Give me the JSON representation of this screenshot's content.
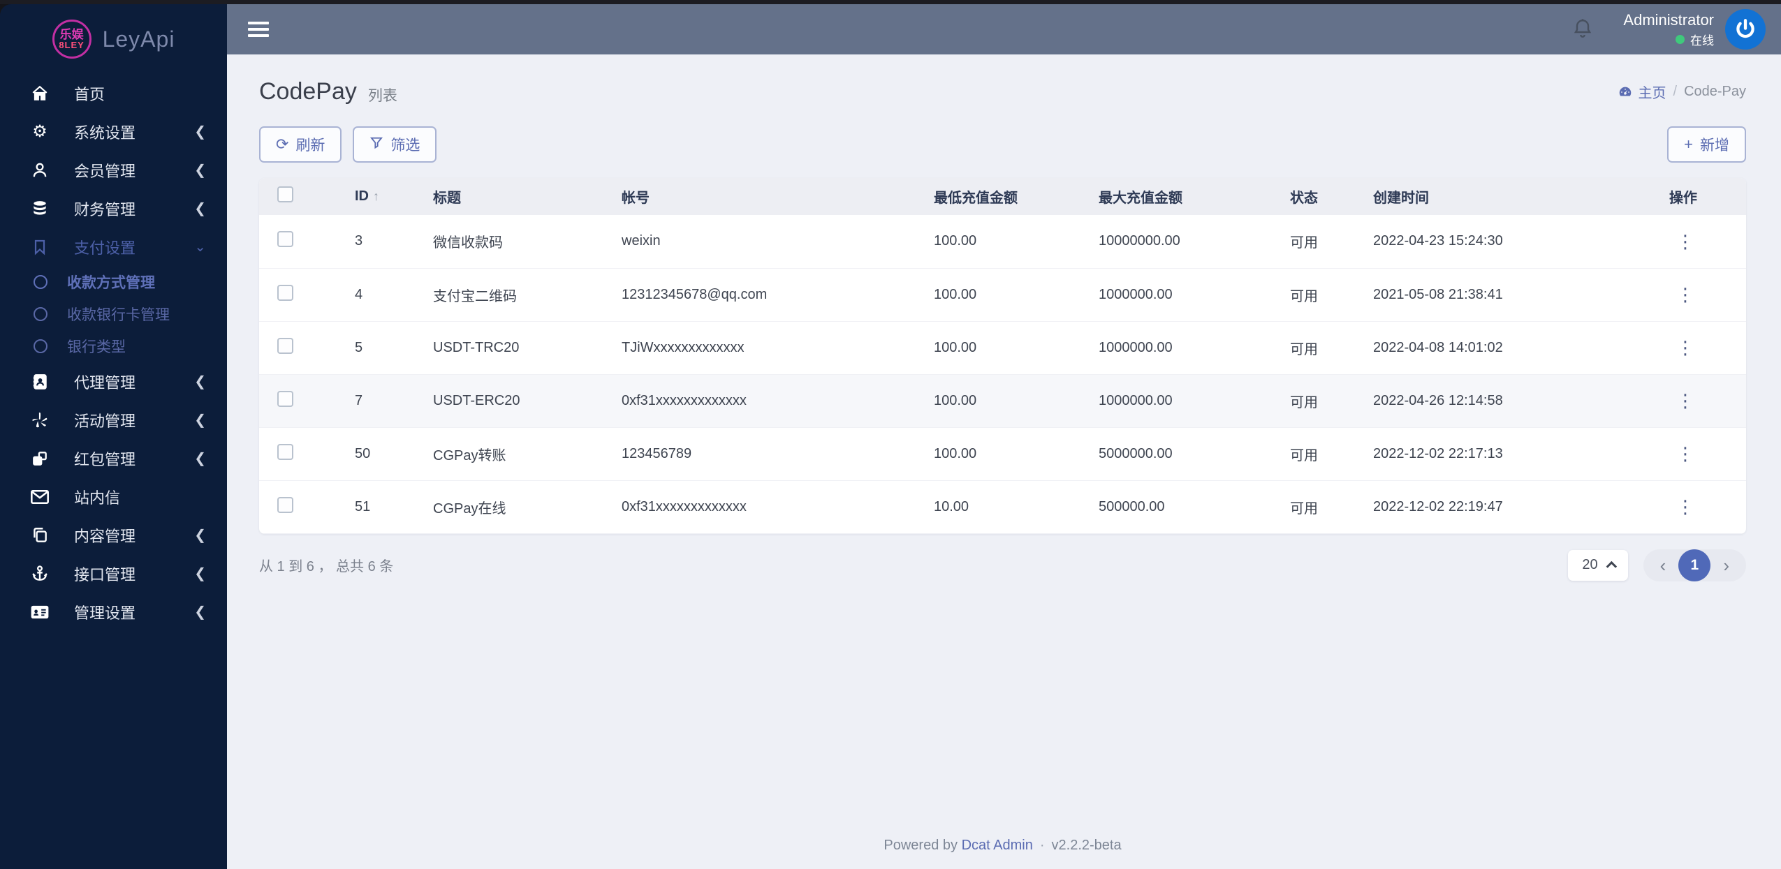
{
  "sidebar": {
    "logo": {
      "badge_line1": "乐娱",
      "badge_line2": "8LEY",
      "text": "LeyApi"
    },
    "items": [
      {
        "label": "首页"
      },
      {
        "label": "系统设置"
      },
      {
        "label": "会员管理"
      },
      {
        "label": "财务管理"
      },
      {
        "label": "支付设置"
      },
      {
        "label": "代理管理"
      },
      {
        "label": "活动管理"
      },
      {
        "label": "红包管理"
      },
      {
        "label": "站内信"
      },
      {
        "label": "内容管理"
      },
      {
        "label": "接口管理"
      },
      {
        "label": "管理设置"
      }
    ],
    "sub_items": [
      {
        "label": "收款方式管理"
      },
      {
        "label": "收款银行卡管理"
      },
      {
        "label": "银行类型"
      }
    ]
  },
  "header": {
    "user_name": "Administrator",
    "status": "在线"
  },
  "page": {
    "title": "CodePay",
    "subtitle": "列表",
    "breadcrumb_home": "主页",
    "breadcrumb_sep": "/",
    "breadcrumb_current": "Code-Pay"
  },
  "toolbar": {
    "refresh_label": "刷新",
    "filter_label": "筛选",
    "add_label": "新增"
  },
  "table": {
    "columns": [
      "ID",
      "标题",
      "帐号",
      "最低充值金额",
      "最大充值金额",
      "状态",
      "创建时间",
      "操作"
    ],
    "rows": [
      {
        "id": "3",
        "title": "微信收款码",
        "account": "weixin",
        "min": "100.00",
        "max": "10000000.00",
        "status": "可用",
        "created": "2022-04-23 15:24:30",
        "highlight": false
      },
      {
        "id": "4",
        "title": "支付宝二维码",
        "account": "12312345678@qq.com",
        "min": "100.00",
        "max": "1000000.00",
        "status": "可用",
        "created": "2021-05-08 21:38:41",
        "highlight": false
      },
      {
        "id": "5",
        "title": "USDT-TRC20",
        "account": "TJiWxxxxxxxxxxxxx",
        "min": "100.00",
        "max": "1000000.00",
        "status": "可用",
        "created": "2022-04-08 14:01:02",
        "highlight": false
      },
      {
        "id": "7",
        "title": "USDT-ERC20",
        "account": "0xf31xxxxxxxxxxxxx",
        "min": "100.00",
        "max": "1000000.00",
        "status": "可用",
        "created": "2022-04-26 12:14:58",
        "highlight": true
      },
      {
        "id": "50",
        "title": "CGPay转账",
        "account": "123456789",
        "min": "100.00",
        "max": "5000000.00",
        "status": "可用",
        "created": "2022-12-02 22:17:13",
        "highlight": false
      },
      {
        "id": "51",
        "title": "CGPay在线",
        "account": "0xf31xxxxxxxxxxxxx",
        "min": "10.00",
        "max": "500000.00",
        "status": "可用",
        "created": "2022-12-02 22:19:47",
        "highlight": false
      }
    ]
  },
  "pagination": {
    "summary": "从 1 到 6 ， 总共 6 条",
    "per_page": "20",
    "current_page": "1",
    "prev": "‹",
    "next": "›"
  },
  "footer": {
    "powered_by": "Powered by",
    "brand": "Dcat Admin",
    "separator": "·",
    "version": "v2.2.2-beta"
  },
  "colors": {
    "accent": "#5b6cb2",
    "sidebar_bg": "#0c1d3a",
    "topbar_bg": "#64718a",
    "status_green": "#3fc97c",
    "avatar_blue": "#1272d4",
    "active_page_bg": "#5069b8"
  }
}
